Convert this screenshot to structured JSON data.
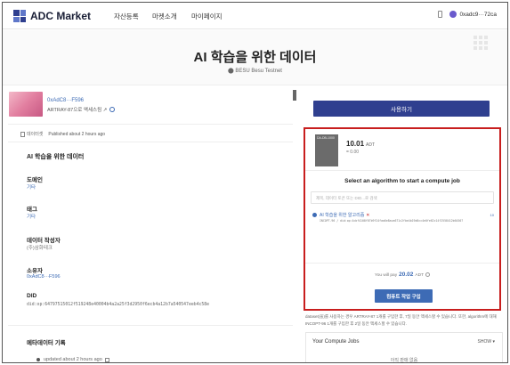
{
  "header": {
    "logo_text": "ADC Market",
    "nav": [
      "자산등록",
      "마켓소개",
      "마이페이지"
    ],
    "wallet_address": "0xadc9···72ca"
  },
  "hero": {
    "title": "AI 학습을 위한 데이터",
    "network": "BESU Besu Testnet"
  },
  "owner": {
    "address": "0xAdC8···F596",
    "note": "ARTRAY-87으로 액세스됨 ↗"
  },
  "meta": {
    "tag": "데이터셋",
    "published": "Published about 2 hours ago"
  },
  "details": {
    "section_title": "AI 학습을 위한 데이터",
    "domain_label": "도메인",
    "domain_value": "기타",
    "tag_label": "태그",
    "tag_value": "기타",
    "author_label": "데이터 작성자",
    "author_value": "(주)삼화테크",
    "owner_label": "소유자",
    "owner_value": "0xAdC8···F596",
    "did_label": "DID",
    "did_value": "did:op:64797515012f519248e40004b4a2a25f3d2950f6ecb4a12b7a540547eeb4c58e"
  },
  "history": {
    "title": "메타데이터 기록",
    "entry": "updated about 2 hours ago"
  },
  "use_button": "사용하기",
  "compute": {
    "thumb_label": "DA-DB-1000",
    "price": "10.01",
    "price_unit": "ADT",
    "price_sub": "= 0.00",
    "select_title": "Select an algorithm to start a compute job",
    "search_placeholder": "제목, 데이터 토큰 또는 DID...로 검색",
    "algorithm_name": "AI 학습을 위한 알고리즘",
    "algorithm_did": "INCOPT-96 / did:op:4cbf4108f07b9f24faa6e8aca671c2fbe4b19d6cc4e0fe62c14f2558412b64507",
    "algorithm_price": "10",
    "pay_prefix": "You will pay",
    "pay_amount": "20.02",
    "pay_unit": "ADT",
    "buy_button": "컴퓨트 작업 구입"
  },
  "notice": {
    "line1": "dataset(을)를 사용하는 경우 ARTRAY-87 1개를 구입한 후, 7일 동안 액세스할 수 있습니다. 또한, algorithm에 대해 INCOPT-96 1개를 구입한 후 2일 동안 액세스할 수 있습니다."
  },
  "jobs": {
    "title": "Your Compute Jobs",
    "show": "SHOW ▾",
    "empty": "아직 판매 없음"
  }
}
